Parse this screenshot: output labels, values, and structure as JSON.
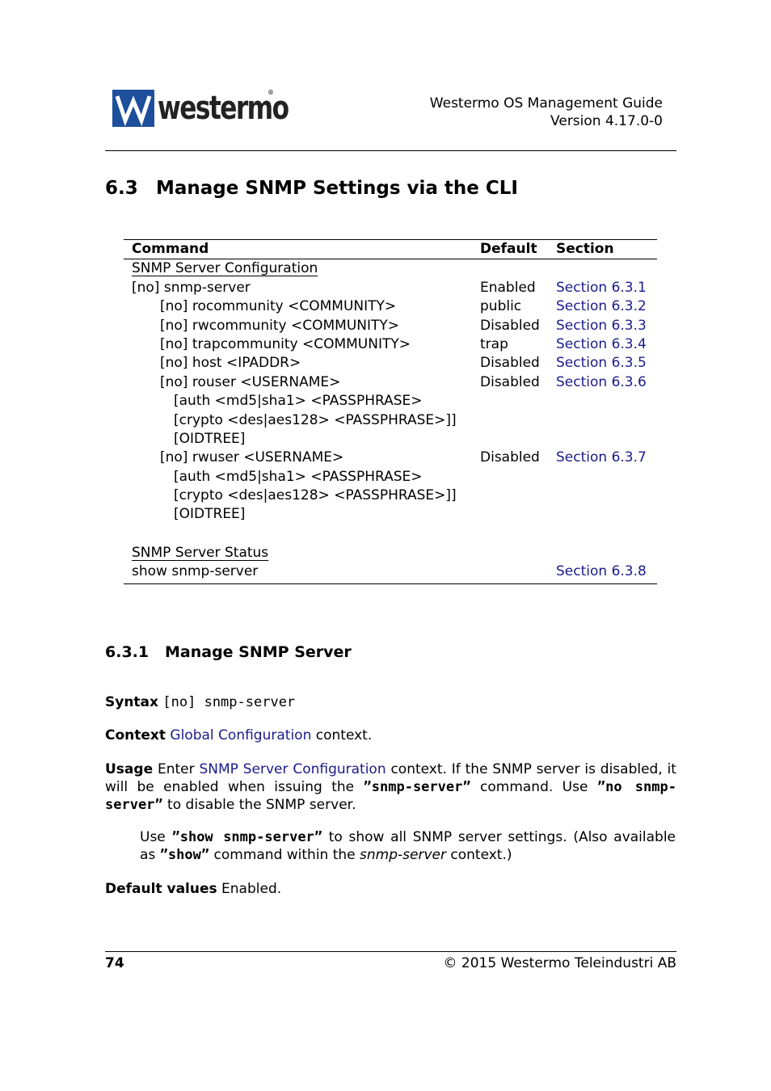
{
  "header": {
    "logo_text": "westermo",
    "logo_registered": "®",
    "doc_title": "Westermo OS Management Guide",
    "version": "Version 4.17.0-0"
  },
  "section": {
    "number": "6.3",
    "title": "Manage SNMP Settings via the CLI"
  },
  "table": {
    "headers": {
      "command": "Command",
      "default": "Default",
      "section": "Section"
    },
    "groups": [
      {
        "title": "SNMP Server Configuration",
        "rows": [
          {
            "command": "[no] snmp-server",
            "indent": 0,
            "default": "Enabled",
            "section": "Section 6.3.1"
          },
          {
            "command": "[no] rocommunity <COMMUNITY>",
            "indent": 1,
            "default": "public",
            "section": "Section 6.3.2"
          },
          {
            "command": "[no] rwcommunity <COMMUNITY>",
            "indent": 1,
            "default": "Disabled",
            "section": "Section 6.3.3"
          },
          {
            "command": "[no] trapcommunity <COMMUNITY>",
            "indent": 1,
            "default": "trap",
            "section": "Section 6.3.4"
          },
          {
            "command": "[no] host <IPADDR>",
            "indent": 1,
            "default": "Disabled",
            "section": "Section 6.3.5"
          },
          {
            "command": "[no] rouser <USERNAME>",
            "indent": 1,
            "default": "Disabled",
            "section": "Section 6.3.6"
          },
          {
            "command": "[auth <md5|sha1> <PASSPHRASE>",
            "indent": 2,
            "default": "",
            "section": ""
          },
          {
            "command": "[crypto <des|aes128> <PASSPHRASE>]]",
            "indent": 2,
            "default": "",
            "section": ""
          },
          {
            "command": "[OIDTREE]",
            "indent": 2,
            "default": "",
            "section": ""
          },
          {
            "command": "[no] rwuser <USERNAME>",
            "indent": 1,
            "default": "Disabled",
            "section": "Section 6.3.7"
          },
          {
            "command": "[auth <md5|sha1> <PASSPHRASE>",
            "indent": 2,
            "default": "",
            "section": ""
          },
          {
            "command": "[crypto <des|aes128> <PASSPHRASE>]]",
            "indent": 2,
            "default": "",
            "section": ""
          },
          {
            "command": "[OIDTREE]",
            "indent": 2,
            "default": "",
            "section": ""
          }
        ]
      },
      {
        "title": "SNMP Server Status",
        "rows": [
          {
            "command": "show snmp-server",
            "indent": 0,
            "default": "",
            "section": "Section 6.3.8"
          }
        ]
      }
    ]
  },
  "subsection": {
    "number": "6.3.1",
    "title": "Manage SNMP Server",
    "syntax_label": "Syntax",
    "syntax_value": "[no] snmp-server",
    "context_label": "Context",
    "context_link": "Global Configuration",
    "context_rest": " context.",
    "usage_label": "Usage",
    "usage_pre": "Enter ",
    "usage_link": "SNMP Server Configuration",
    "usage_p1_a": " context. If the SNMP server is disabled, it will be enabled when issuing the ",
    "usage_p1_cmd1": "”snmp-server”",
    "usage_p1_b": " command.  Use ",
    "usage_p1_cmd2": "”no snmp-server”",
    "usage_p1_c": " to disable the SNMP server.",
    "usage_p2_a": "Use ",
    "usage_p2_cmd1": "”show snmp-server”",
    "usage_p2_b": " to show all SNMP server settings. (Also available as ",
    "usage_p2_cmd2": "”show”",
    "usage_p2_c": " command within the ",
    "usage_p2_italic": "snmp-server",
    "usage_p2_d": " context.)",
    "default_label": "Default values",
    "default_value": "Enabled."
  },
  "footer": {
    "page_number": "74",
    "copyright_symbol": "©",
    "copyright_text": " 2015 Westermo Teleindustri AB"
  },
  "colors": {
    "link": "#1b1b8c",
    "logo_blue": "#1d4f9c"
  }
}
